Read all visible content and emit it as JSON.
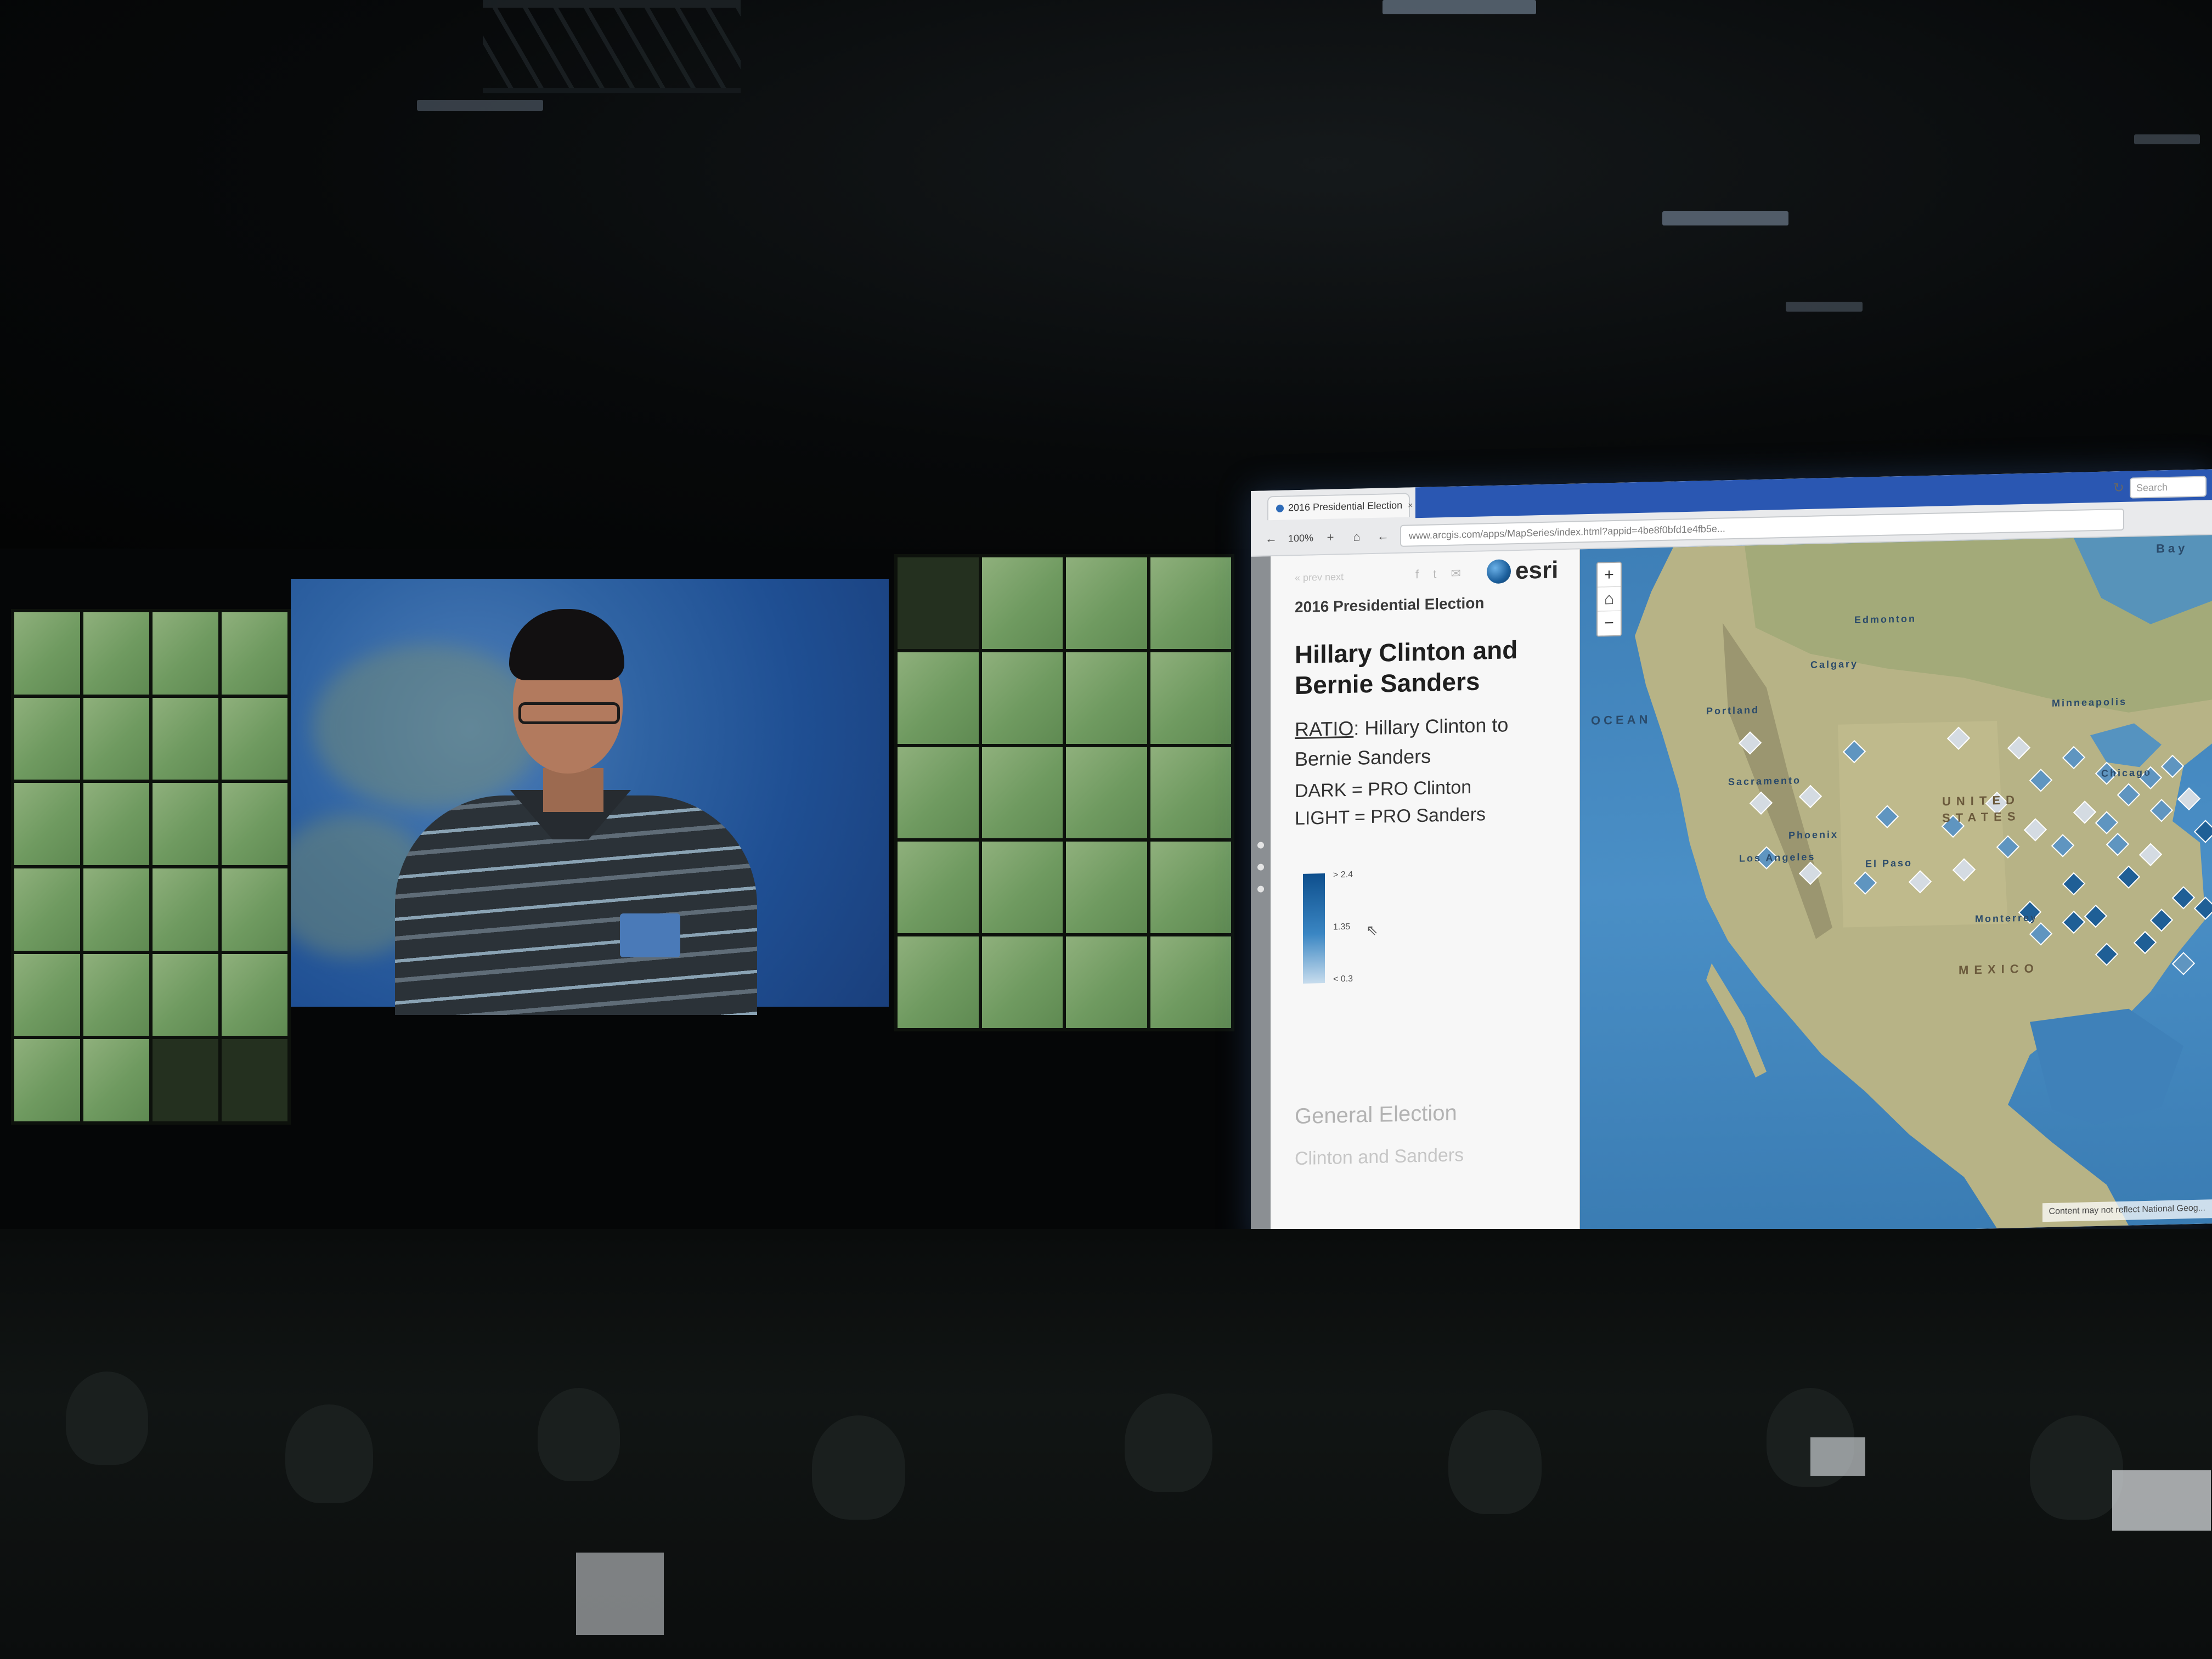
{
  "browser": {
    "tab_title": "2016 Presidential Election",
    "tab_close": "×",
    "zoom": "100%",
    "url": "www.arcgis.com/apps/MapSeries/index.html?appid=4be8f0bfd1e4fb5e...",
    "search_placeholder": "Search",
    "back": "←",
    "forward": "→",
    "home": "⌂",
    "plus": "+",
    "refresh": "↻"
  },
  "panel": {
    "faded_link": "« prev  next",
    "share": "f  t  ✉",
    "logo_text": "esri",
    "subtitle": "2016 Presidential Election",
    "title": "Hillary Clinton and Bernie Sanders",
    "ratio_keyword": "RATIO",
    "ratio_rest": ": Hillary Clinton to Bernie Sanders",
    "dark_line": "DARK = PRO Clinton",
    "light_line": "LIGHT = PRO Sanders",
    "legend": {
      "high": "> 2.4",
      "mid": "1.35",
      "low": "< 0.3"
    },
    "section_general": "General Election",
    "section_clinton_sanders": "Clinton and Sanders"
  },
  "map": {
    "zoom_in": "+",
    "home_icon": "⌂",
    "zoom_out": "−",
    "labels": {
      "ocean": "OCEAN",
      "united_states": "UNITED STATES",
      "mexico": "MEXICO",
      "bay": "Bay",
      "edmonton": "Edmonton",
      "calgary": "Calgary",
      "portland": "Portland",
      "sacramento": "Sacramento",
      "los_angeles": "Los Angeles",
      "phoenix": "Phoenix",
      "el_paso": "El Paso",
      "monterrey": "Monterrey",
      "minneapolis": "Minneapolis",
      "chicago": "Chicago"
    },
    "attribution": "Content may not reflect National Geog...",
    "symbol_colors": {
      "dark": "#1f5f96",
      "mid": "#5f95c0",
      "light": "#d4dbe2"
    }
  },
  "colors": {
    "browser_accent": "#2a57b2",
    "tile_green": "#7ea56b",
    "video_blue": "#2f63a3"
  }
}
